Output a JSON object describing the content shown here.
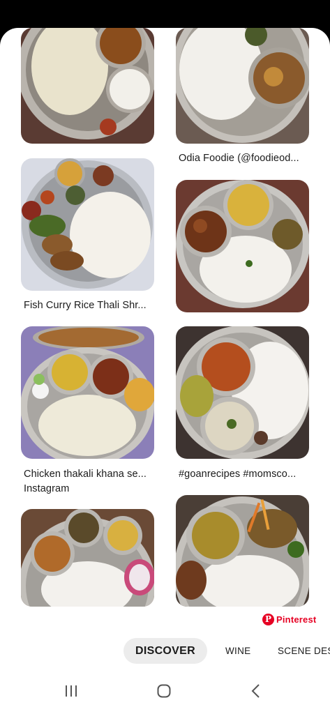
{
  "feed": {
    "cards": [
      {
        "caption": ""
      },
      {
        "caption": "Odia Foodie (@foodieod..."
      },
      {
        "caption": "Fish Curry Rice Thali Shr..."
      },
      {
        "caption": ""
      },
      {
        "caption": "Chicken thakali khana se...",
        "caption_line2": "Instagram"
      },
      {
        "caption": "#goanrecipes #momsco..."
      },
      {
        "caption": ""
      },
      {
        "caption": ""
      }
    ]
  },
  "brand": {
    "label": "Pinterest",
    "glyph": "P",
    "color": "#e60023"
  },
  "tabs": [
    {
      "label": "DISCOVER",
      "active": true
    },
    {
      "label": "WINE",
      "active": false
    },
    {
      "label": "SCENE DESC",
      "active": false
    }
  ],
  "navbar": {
    "icons": [
      "recent-apps-icon",
      "home-icon",
      "back-icon"
    ]
  }
}
